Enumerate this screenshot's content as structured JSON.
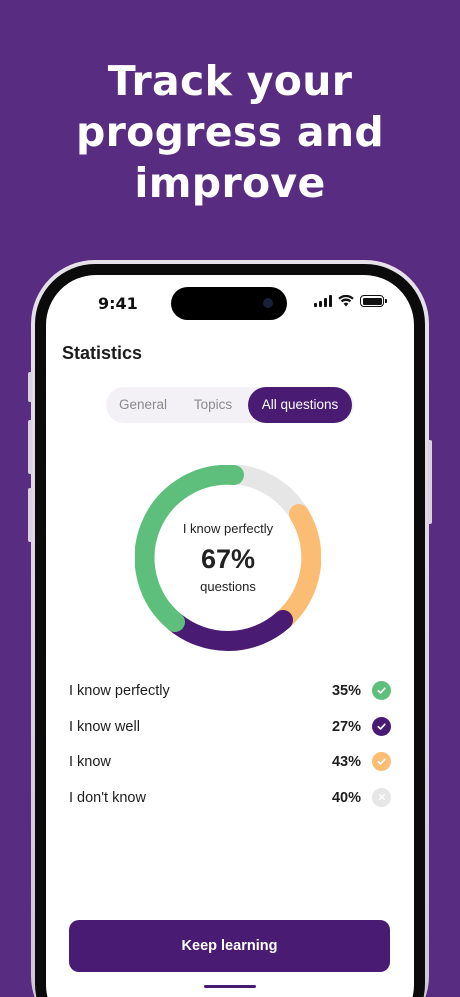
{
  "headline": {
    "line1": "Track your",
    "line2": "progress and",
    "line3": "improve"
  },
  "status_bar": {
    "time": "9:41",
    "icons": [
      "cellular-signal-icon",
      "wifi-icon",
      "battery-icon"
    ]
  },
  "screen": {
    "title": "Statistics",
    "tabs": [
      {
        "label": "General",
        "active": false
      },
      {
        "label": "Topics",
        "active": false
      },
      {
        "label": "All questions",
        "active": true
      }
    ],
    "donut": {
      "label": "I know perfectly",
      "value": "67%",
      "sublabel": "questions",
      "segments": [
        {
          "name": "I know perfectly",
          "color": "#5dbf7b"
        },
        {
          "name": "I know well",
          "color": "#4a1b73"
        },
        {
          "name": "I know",
          "color": "#fbbd74"
        },
        {
          "name": "I don't know",
          "color": "#e6e6e6"
        }
      ]
    },
    "legend": [
      {
        "label": "I know perfectly",
        "value": "35%",
        "color": "#5dbf7b",
        "icon": "check-icon"
      },
      {
        "label": "I know well",
        "value": "27%",
        "color": "#4a1b73",
        "icon": "check-icon"
      },
      {
        "label": "I know",
        "value": "43%",
        "color": "#fbbd74",
        "icon": "check-icon"
      },
      {
        "label": "I don't know",
        "value": "40%",
        "color": "#e6e6e6",
        "icon": "x-icon"
      }
    ],
    "cta_label": "Keep learning"
  },
  "colors": {
    "background": "#582c80",
    "accent": "#4a1b73",
    "green": "#5dbf7b",
    "orange": "#fbbd74",
    "grey": "#e6e6e6"
  }
}
